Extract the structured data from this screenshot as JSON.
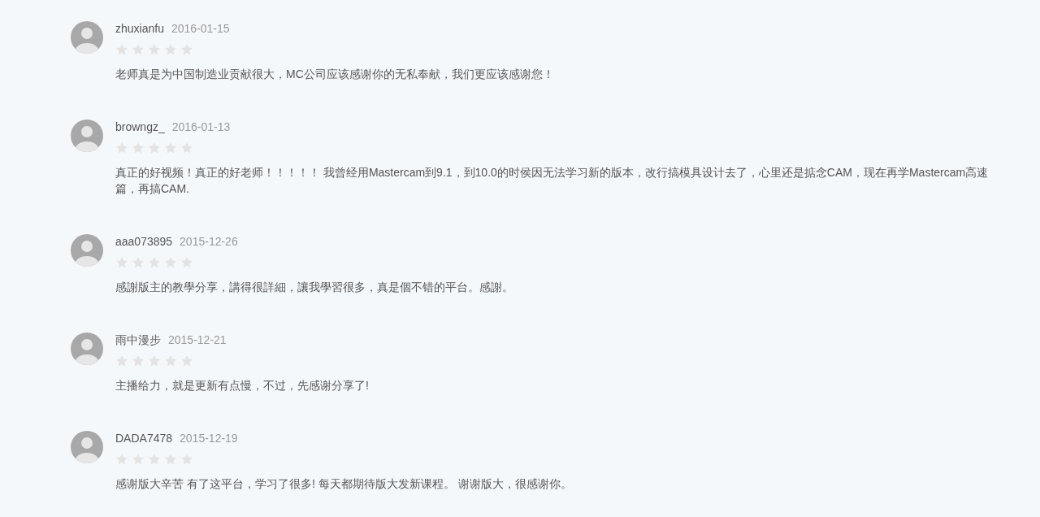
{
  "comments": [
    {
      "user": "zhuxianfu",
      "date": "2016-01-15",
      "stars": 0,
      "text": "老师真是为中国制造业贡献很大，MC公司应该感谢你的无私奉献，我们更应该感谢您！"
    },
    {
      "user": "browngz_",
      "date": "2016-01-13",
      "stars": 0,
      "text": "真正的好视频！真正的好老师！！！！！ 我曾经用Mastercam到9.1，到10.0的时侯因无法学习新的版本，改行搞模具设计去了，心里还是掂念CAM，现在再学Mastercam高速篇，再搞CAM."
    },
    {
      "user": "aaa073895",
      "date": "2015-12-26",
      "stars": 0,
      "text": "感謝版主的教學分享，講得很詳細，讓我學習很多，真是個不错的平台。感謝。"
    },
    {
      "user": "雨中漫步",
      "date": "2015-12-21",
      "stars": 0,
      "text": "主播给力，就是更新有点慢，不过，先感谢分享了!"
    },
    {
      "user": "DADA7478",
      "date": "2015-12-19",
      "stars": 0,
      "text": "感谢版大辛苦 有了这平台，学习了很多! 每天都期待版大发新课程。 谢谢版大，很感谢你。"
    }
  ]
}
